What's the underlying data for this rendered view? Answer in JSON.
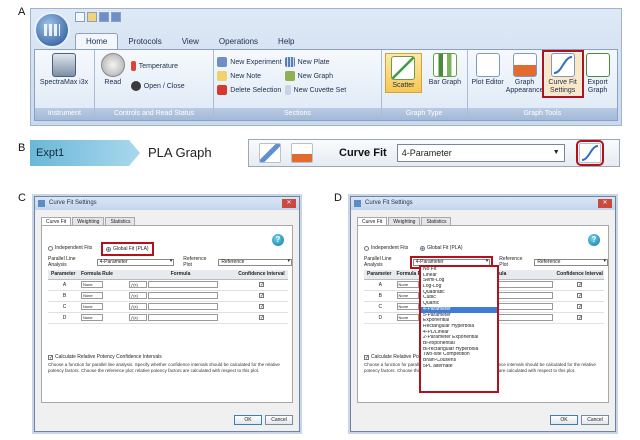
{
  "labels": {
    "a": "A",
    "b": "B",
    "c": "C",
    "d": "D"
  },
  "ribbon": {
    "tabs": [
      "Home",
      "Protocols",
      "View",
      "Operations",
      "Help"
    ],
    "active_tab": "Home",
    "instrument": {
      "device": "SpectraMax i3x",
      "group": "Instrument"
    },
    "controls": {
      "read": "Read",
      "temperature": "Temperature",
      "open_close": "Open / Close",
      "group": "Controls and Read Status"
    },
    "sections": {
      "new_experiment": "New Experiment",
      "new_note": "New Note",
      "delete_selection": "Delete Selection",
      "new_plate": "New Plate",
      "new_graph": "New Graph",
      "new_cuvette_set": "New Cuvette Set",
      "group": "Sections"
    },
    "graph_type": {
      "scatter": "Scatter",
      "bar": "Bar Graph",
      "group": "Graph Type"
    },
    "graph_tools": {
      "plot_editor": "Plot Editor",
      "graph_appearance": "Graph Appearance",
      "curve_fit_settings": "Curve Fit Settings",
      "export_graph": "Export Graph",
      "group": "Graph Tools"
    }
  },
  "toolbar": {
    "experiment": "Expt1",
    "graph": "PLA Graph",
    "curve_fit_label": "Curve Fit",
    "curve_fit_value": "4-Parameter"
  },
  "dialog_c": {
    "title": "Curve Fit Settings",
    "tabs": [
      "Curve Fit",
      "Weighting",
      "Statistics"
    ],
    "independent_fits": "Independent Fits",
    "global_fit": "Global Fit (PLA)",
    "parallel_line_label": "Parallel Line Analysis",
    "parallel_line_value": "4-Parameter",
    "reference_plot_label": "Reference Plot",
    "reference_plot_value": "Reference",
    "columns": [
      "Parameter",
      "Formula Rule",
      "Formula",
      "Confidence Interval"
    ],
    "rows": [
      {
        "param": "A",
        "rule": "None",
        "fx": "ƒ(x)"
      },
      {
        "param": "B",
        "rule": "None",
        "fx": "ƒ(x)"
      },
      {
        "param": "C",
        "rule": "None",
        "fx": "ƒ(x)"
      },
      {
        "param": "D",
        "rule": "None",
        "fx": "ƒ(x)"
      }
    ],
    "relative_potency": "Calculate Relative Potency Confidence Intervals",
    "description": "Choose a function for parallel line analysis. Specify whether confidence intervals should be calculated for the relative potency factors. Choose the reference plot; relative potency factors are calculated with respect to this plot.",
    "ok": "OK",
    "cancel": "Cancel"
  },
  "dialog_d": {
    "title": "Curve Fit Settings",
    "tabs": [
      "Curve Fit",
      "Weighting",
      "Statistics"
    ],
    "independent_fits": "Independent Fits",
    "global_fit": "Global Fit (PLA)",
    "parallel_line_label": "Parallel Line Analysis",
    "parallel_line_value": "4-Parameter",
    "reference_plot_label": "Reference Plot",
    "reference_plot_value": "Reference",
    "columns": [
      "Parameter",
      "Formula Rule",
      "Formula",
      "Confidence Interval"
    ],
    "rows": [
      {
        "param": "A",
        "rule": "None"
      },
      {
        "param": "B",
        "rule": "None"
      },
      {
        "param": "C",
        "rule": "None"
      },
      {
        "param": "D",
        "rule": "None"
      }
    ],
    "relative_potency": "Calculate Relative Potency Confidence Intervals",
    "description": "Choose a function for parallel line analysis. Specify whether confidence intervals should be calculated for the relative potency factors. Choose the reference plot; relative potency factors are calculated with respect to this plot.",
    "options": [
      "No Fit",
      "Linear",
      "Semi-Log",
      "Log-Log",
      "Quadratic",
      "Cubic",
      "Quartic",
      "4-Parameter",
      "5-Parameter",
      "Exponential",
      "Rectangular Hyperbola",
      "4-PL/Linear",
      "2-Parameter Exponential",
      "Bi-exponential",
      "Bi-rectangular Hyperbola",
      "Two-site Competition",
      "Brain-Cousens",
      "5PL alternate"
    ],
    "highlighted": "4-Parameter",
    "ok": "OK",
    "cancel": "Cancel"
  },
  "colors": {
    "highlight_red": "#b3121c",
    "accent_blue": "#3f7cd6",
    "ribbon_bg": "#dde8f5"
  }
}
